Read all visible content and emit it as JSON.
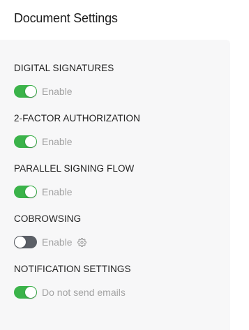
{
  "page": {
    "title": "Document Settings"
  },
  "settings": [
    {
      "title": "DIGITAL SIGNATURES",
      "toggle_state": "on",
      "toggle_label": "Enable",
      "has_gear": false
    },
    {
      "title": "2-FACTOR AUTHORIZATION",
      "toggle_state": "on",
      "toggle_label": "Enable",
      "has_gear": false
    },
    {
      "title": "PARALLEL SIGNING FLOW",
      "toggle_state": "on",
      "toggle_label": "Enable",
      "has_gear": false
    },
    {
      "title": "COBROWSING",
      "toggle_state": "off",
      "toggle_label": "Enable",
      "has_gear": true,
      "gear_icon": "gear-icon"
    },
    {
      "title": "NOTIFICATION SETTINGS",
      "toggle_state": "on",
      "toggle_label": "Do not send emails",
      "has_gear": false
    }
  ],
  "colors": {
    "toggle_on": "#3bb34a",
    "toggle_off": "#5b5f66",
    "panel_bg": "#f7f7f8",
    "label_muted": "#a3a3a3"
  }
}
